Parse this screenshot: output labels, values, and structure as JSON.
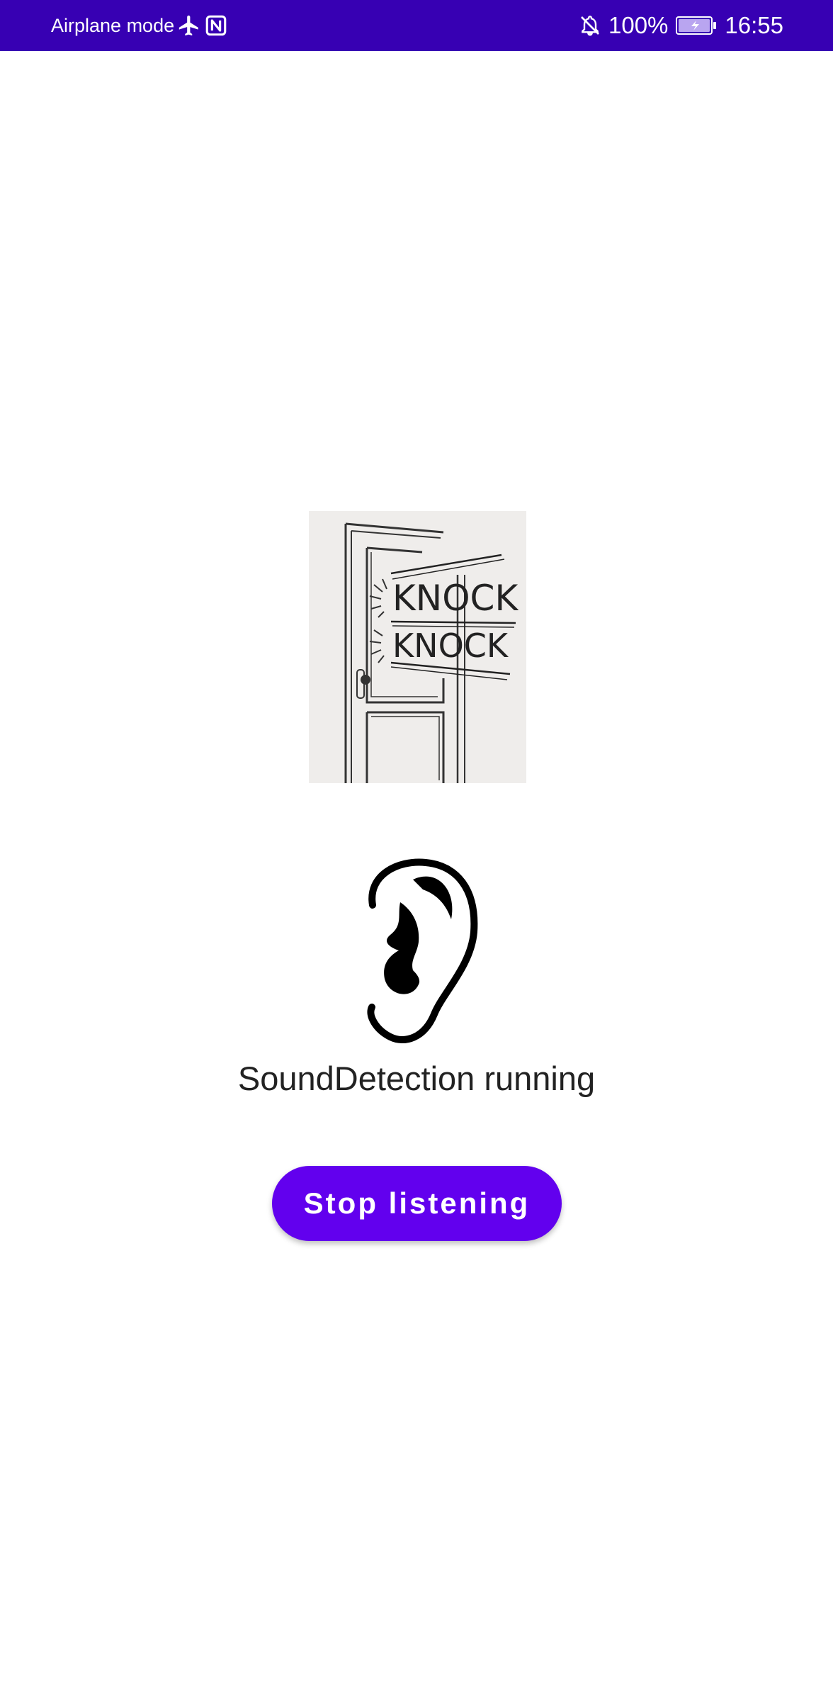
{
  "status_bar": {
    "left_text": "Airplane mode",
    "battery": "100%",
    "time": "16:55",
    "icons": [
      "airplane-icon",
      "nfc-icon",
      "bell-off-icon",
      "battery-charging-icon"
    ],
    "background": "#3700b3"
  },
  "main": {
    "image_alt_icon": "knock-door-illustration",
    "image_words": [
      "KNOCK",
      "KNOCK"
    ],
    "ear_icon": "ear-icon",
    "status_text": "SoundDetection running",
    "button_label": "Stop listening",
    "button_color": "#6200ee"
  }
}
